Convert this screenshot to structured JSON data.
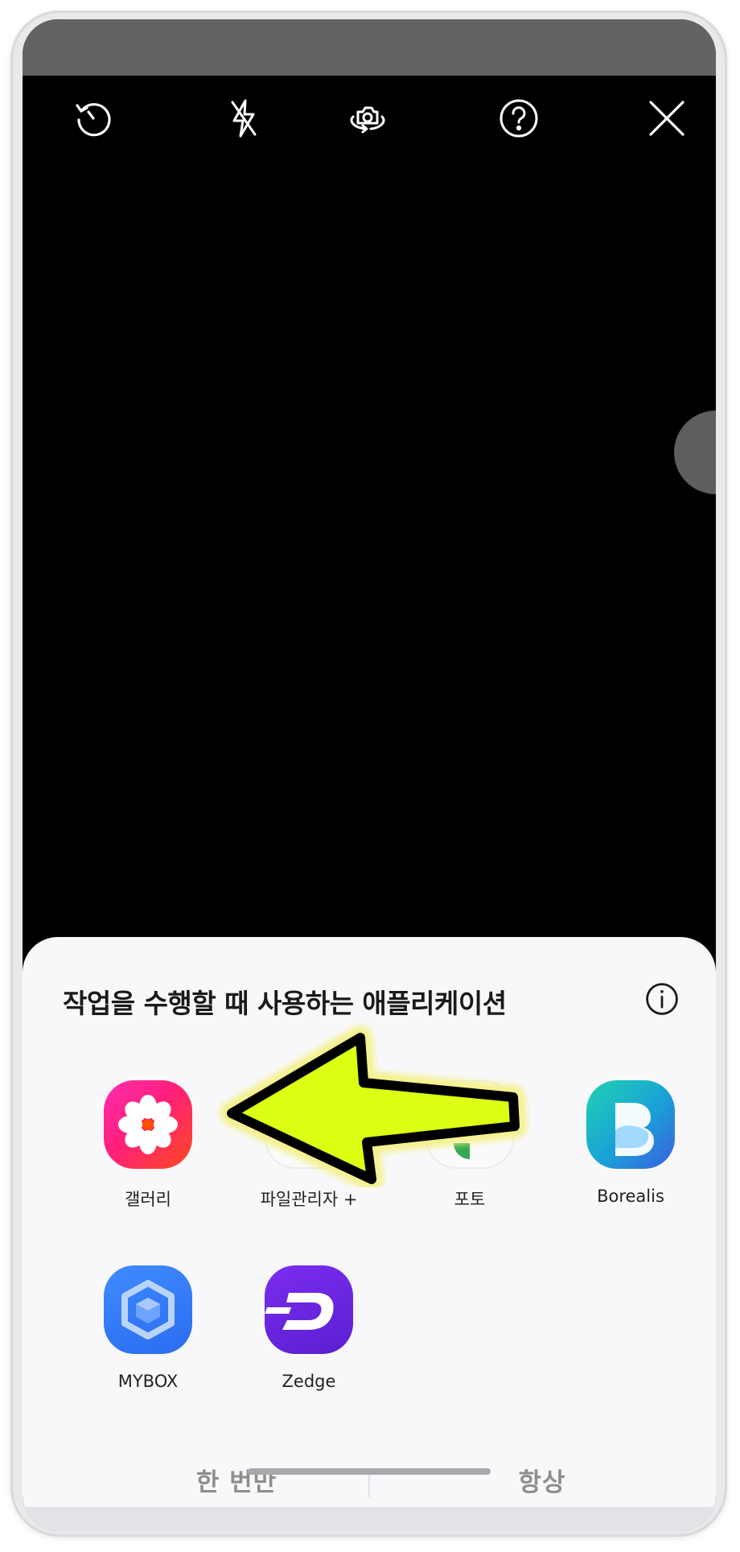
{
  "sheet": {
    "title": "작업을 수행할 때 사용하는 애플리케이션",
    "apps": [
      {
        "label": "갤러리",
        "icon": "gallery-icon"
      },
      {
        "label": "파일관리자 +",
        "icon": "file-manager-icon"
      },
      {
        "label": "포토",
        "icon": "photos-icon"
      },
      {
        "label": "Borealis",
        "icon": "borealis-icon"
      },
      {
        "label": "MYBOX",
        "icon": "mybox-icon"
      },
      {
        "label": "Zedge",
        "icon": "zedge-icon"
      }
    ],
    "buttons": {
      "once": "한 번만",
      "always": "항상"
    }
  },
  "toolbar": {
    "icons": [
      "timer-icon",
      "flash-off-icon",
      "switch-camera-icon",
      "help-icon",
      "close-icon"
    ]
  },
  "colors": {
    "status_bar": "#636363",
    "sheet_bg": "#f8f8fb",
    "arrow_fill": "#dcff14",
    "arrow_glow": "#f3f07a"
  }
}
